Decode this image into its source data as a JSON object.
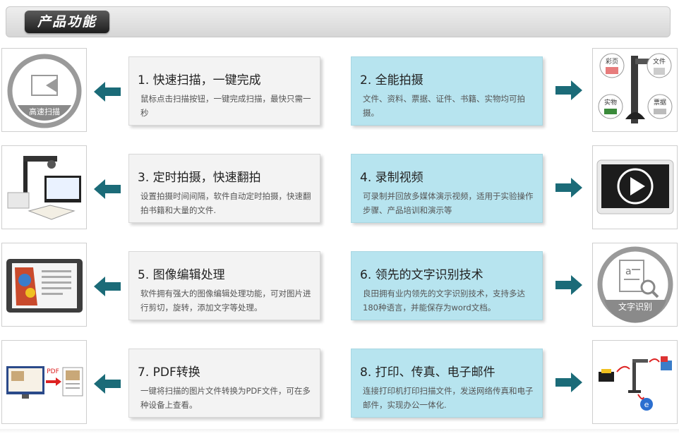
{
  "header": {
    "title": "产品功能"
  },
  "colors": {
    "accent": "#1b6b78",
    "card_blue": "#b7e4ef",
    "card_gray": "#f3f3f3"
  },
  "features": [
    {
      "title": "1. 快速扫描，一键完成",
      "desc": "鼠标点击扫描按钮，一键完成扫描，最快只需一秒",
      "thumb_label": "高速扫描",
      "icon": "scanner-icon"
    },
    {
      "title": "2. 全能拍摄",
      "desc": "文件、资料、票据、证件、书籍、实物均可拍摄。",
      "thumb_labels": [
        "彩页",
        "文件",
        "实物",
        "票据"
      ],
      "icon": "document-camera-icon"
    },
    {
      "title": "3. 定时拍摄，快速翻拍",
      "desc": "设置拍摄时间间隔，软件自动定时拍摄，快速翻拍书籍和大量的文件.",
      "icon": "book-scanning-icon"
    },
    {
      "title": "4. 录制视频",
      "desc": "可录制并回放多媒体演示视频，适用于实验操作步骤、产品培训和演示等",
      "icon": "video-play-icon"
    },
    {
      "title": "5. 图像编辑处理",
      "desc": "软件拥有强大的图像编辑处理功能，可对图片进行剪切，旋转，添加文字等处理。",
      "icon": "image-edit-icon"
    },
    {
      "title": "6. 领先的文字识别技术",
      "desc": "良田拥有业内领先的文字识别技术，支持多达180种语言，并能保存为word文档。",
      "thumb_label": "文字识别",
      "icon": "ocr-icon"
    },
    {
      "title": "7. PDF转换",
      "desc": "一键将扫描的图片文件转换为PDF文件，可在多种设备上查看。",
      "thumb_label": "PDF",
      "icon": "pdf-convert-icon"
    },
    {
      "title": "8. 打印、传真、电子邮件",
      "desc": "连接打印机打印扫描文件，发送网络传真和电子邮件，实现办公一体化.",
      "icon": "print-fax-email-icon"
    }
  ]
}
